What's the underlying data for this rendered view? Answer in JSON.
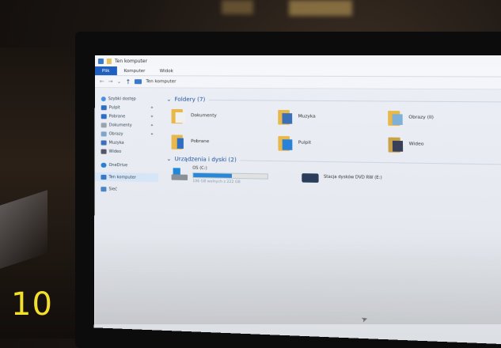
{
  "window": {
    "title": "Ten komputer"
  },
  "ribbon": {
    "tabs": [
      "Plik",
      "Komputer",
      "Widok"
    ]
  },
  "address": {
    "path": "Ten komputer"
  },
  "sidebar": {
    "items": [
      {
        "label": "Szybki dostęp",
        "icon": "star-icon"
      },
      {
        "label": "Pulpit",
        "icon": "desktop-icon"
      },
      {
        "label": "Pobrane",
        "icon": "download-icon"
      },
      {
        "label": "Dokumenty",
        "icon": "documents-icon"
      },
      {
        "label": "Obrazy",
        "icon": "pictures-icon"
      },
      {
        "label": "Muzyka",
        "icon": "music-icon"
      },
      {
        "label": "Wideo",
        "icon": "video-icon"
      },
      {
        "label": "OneDrive",
        "icon": "cloud-icon"
      },
      {
        "label": "Ten komputer",
        "icon": "computer-icon"
      },
      {
        "label": "Sieć",
        "icon": "network-icon"
      }
    ]
  },
  "folders": {
    "heading": "Foldery (7)",
    "items": [
      {
        "label": "Dokumenty",
        "icon": "documents-folder-icon"
      },
      {
        "label": "Muzyka",
        "icon": "music-folder-icon"
      },
      {
        "label": "Obrazy (II)",
        "icon": "pictures-folder-icon"
      },
      {
        "label": "Pobrane",
        "icon": "downloads-folder-icon"
      },
      {
        "label": "Pulpit",
        "icon": "desktop-folder-icon"
      },
      {
        "label": "Wideo",
        "icon": "video-folder-icon"
      }
    ]
  },
  "drives": {
    "heading": "Urządzenia i dyski (2)",
    "items": [
      {
        "label": "OS (C:)",
        "detail": "106 GB wolnych z 222 GB",
        "used_fraction": 0.52,
        "icon": "hard-drive-icon"
      },
      {
        "label": "Stacja dysków DVD RW (E:)",
        "icon": "dvd-drive-icon"
      }
    ]
  },
  "overlay": {
    "frame_number": "10"
  },
  "colors": {
    "accent": "#1f5fbd",
    "folder": "#e9b84a",
    "overlay_text": "#f2e02a"
  }
}
